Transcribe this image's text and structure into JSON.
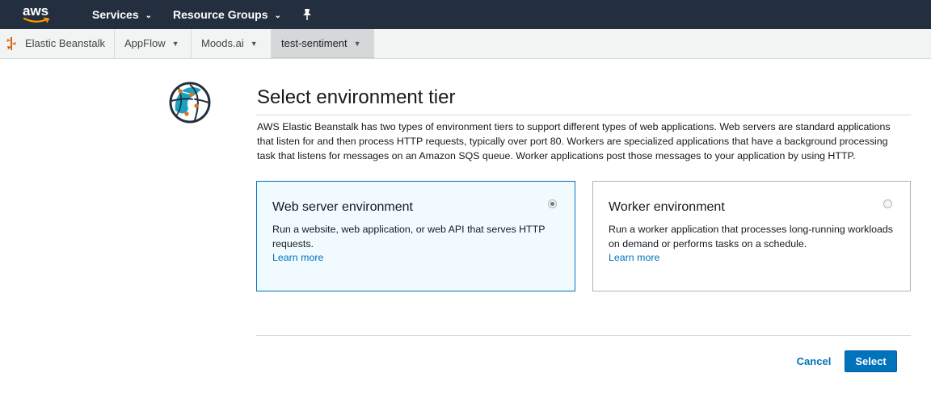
{
  "topnav": {
    "logo_text": "aws",
    "services_label": "Services",
    "resource_groups_label": "Resource Groups"
  },
  "subnav": {
    "tabs": [
      {
        "label": "Elastic Beanstalk"
      },
      {
        "label": "AppFlow"
      },
      {
        "label": "Moods.ai"
      },
      {
        "label": "test-sentiment"
      }
    ]
  },
  "page": {
    "title": "Select environment tier",
    "intro": "AWS Elastic Beanstalk has two types of environment tiers to support different types of web applications. Web servers are standard applications that listen for and then process HTTP requests, typically over port 80. Workers are specialized applications that have a background processing task that listens for messages on an Amazon SQS queue. Worker applications post those messages to your application by using HTTP."
  },
  "tiers": [
    {
      "title": "Web server environment",
      "description": "Run a website, web application, or web API that serves HTTP requests.",
      "link": "Learn more",
      "selected": true
    },
    {
      "title": "Worker environment",
      "description": "Run a worker application that processes long-running workloads on demand or performs tasks on a schedule.",
      "link": "Learn more",
      "selected": false
    }
  ],
  "actions": {
    "cancel_label": "Cancel",
    "select_label": "Select"
  },
  "colors": {
    "navbar_bg": "#232f3e",
    "accent": "#0073bb",
    "aws_orange": "#ff9900",
    "selected_card_bg": "#f1faff"
  }
}
